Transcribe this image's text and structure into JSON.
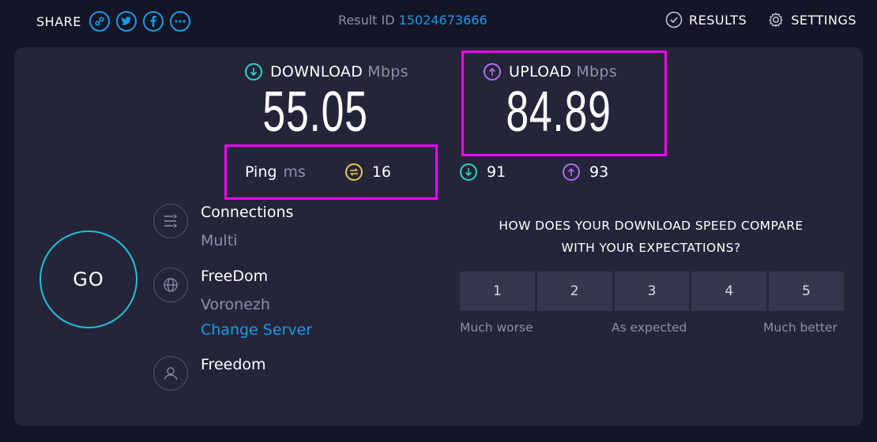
{
  "share": {
    "label": "SHARE",
    "icons": [
      "link-icon",
      "twitter-icon",
      "facebook-icon",
      "more-icon"
    ]
  },
  "result": {
    "label": "Result ID",
    "id": "15024673666"
  },
  "nav": {
    "results": "RESULTS",
    "settings": "SETTINGS"
  },
  "download": {
    "label": "DOWNLOAD",
    "unit": "Mbps",
    "value": "55.05"
  },
  "upload": {
    "label": "UPLOAD",
    "unit": "Mbps",
    "value": "84.89"
  },
  "ping": {
    "label": "Ping",
    "unit": "ms",
    "idle": "16",
    "download": "91",
    "upload": "93"
  },
  "go": {
    "label": "GO"
  },
  "connections": {
    "title": "Connections",
    "value": "Multi"
  },
  "server": {
    "name": "FreeDom",
    "location": "Voronezh",
    "change": "Change Server"
  },
  "provider": {
    "name": "Freedom"
  },
  "survey": {
    "question_line1": "HOW DOES YOUR DOWNLOAD SPEED COMPARE",
    "question_line2": "WITH YOUR EXPECTATIONS?",
    "options": [
      "1",
      "2",
      "3",
      "4",
      "5"
    ],
    "low": "Much worse",
    "mid": "As expected",
    "high": "Much better"
  },
  "colors": {
    "accent": "#1d99e6",
    "download": "#2fd3c1",
    "upload": "#b36cf2",
    "ping": "#e6c84a",
    "highlight": "#ff00ff",
    "go_ring": "#1fc1d6"
  }
}
